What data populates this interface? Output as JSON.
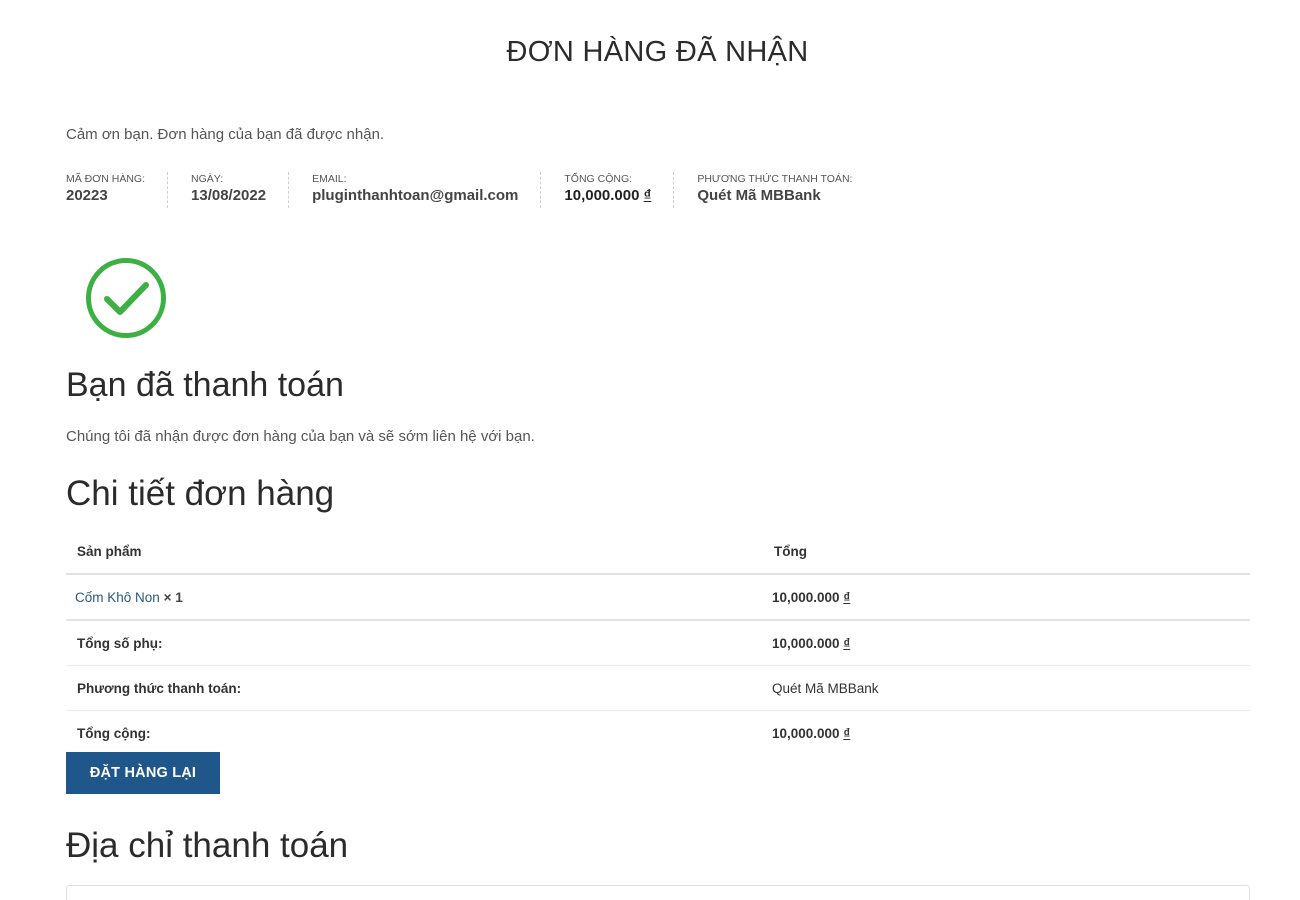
{
  "page": {
    "title": "ĐƠN HÀNG ĐÃ NHẬN",
    "thank_you": "Cảm ơn bạn. Đơn hàng của bạn đã được nhận."
  },
  "overview": {
    "order_label": "MÃ ĐƠN HÀNG:",
    "order_value": "20223",
    "date_label": "NGÀY:",
    "date_value": "13/08/2022",
    "email_label": "EMAIL:",
    "email_value": "pluginthanhtoan@gmail.com",
    "total_label": "TỔNG CỘNG:",
    "total_amount": "10,000.000",
    "currency": "₫",
    "method_label": "PHƯƠNG THỨC THANH TOÁN:",
    "method_value": "Quét Mã MBBank"
  },
  "success": {
    "icon": "check-circle-icon",
    "heading": "Bạn đã thanh toán",
    "message": "Chúng tôi đã nhận được đơn hàng của bạn và sẽ sớm liên hệ với bạn."
  },
  "order_details": {
    "heading": "Chi tiết đơn hàng",
    "col_product": "Sản phẩm",
    "col_total": "Tổng",
    "item": {
      "name": "Cốm Khô Non",
      "qty": "× 1",
      "amount": "10,000.000",
      "currency": "₫"
    },
    "subtotal_label": "Tổng số phụ:",
    "subtotal_amount": "10,000.000",
    "subtotal_currency": "₫",
    "payment_label": "Phương thức thanh toán:",
    "payment_value": "Quét Mã MBBank",
    "grand_total_label": "Tổng cộng:",
    "grand_total_amount": "10,000.000",
    "grand_total_currency": "₫"
  },
  "buttons": {
    "order_again": "ĐẶT HÀNG LẠI"
  },
  "billing": {
    "heading": "Địa chỉ thanh toán"
  },
  "colors": {
    "accent": "#20578a",
    "success": "#3cb043",
    "link": "#2b5b7f"
  }
}
